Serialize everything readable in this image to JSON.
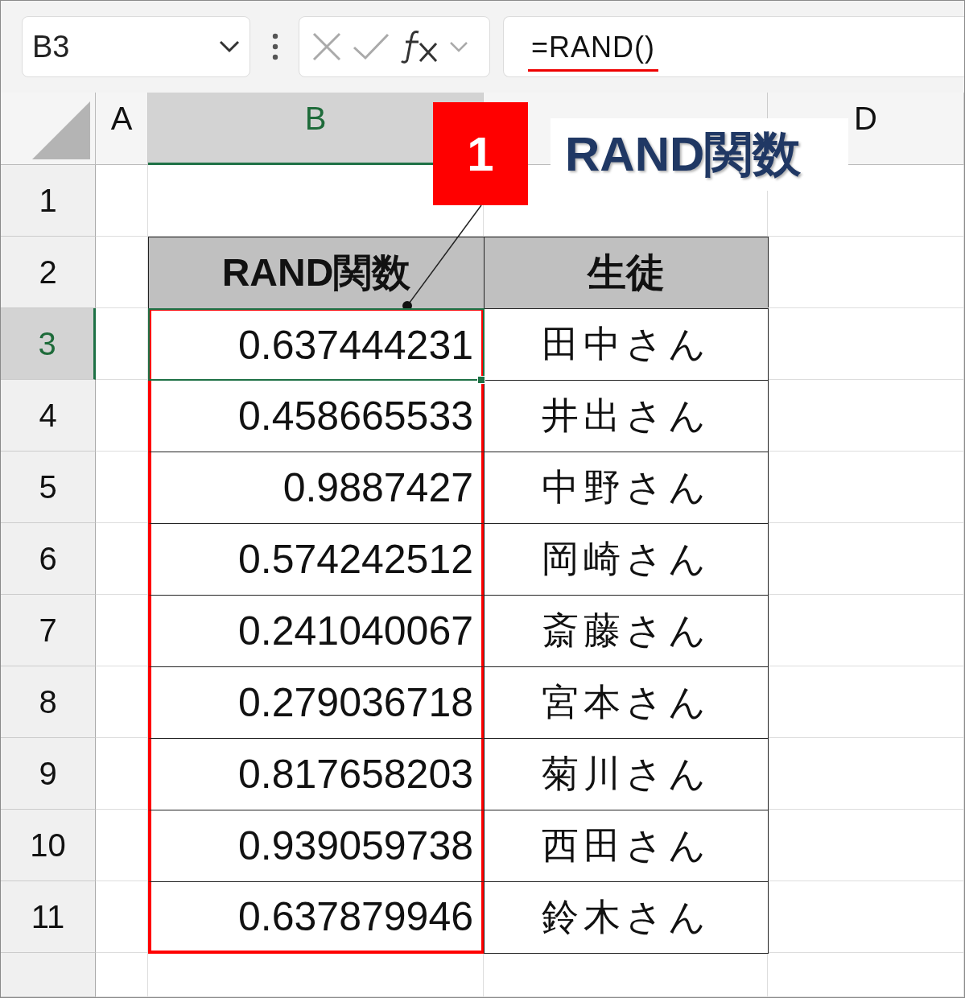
{
  "name_box": {
    "value": "B3"
  },
  "formula_bar": {
    "formula": "=RAND()"
  },
  "columns": [
    {
      "label": "A",
      "selected": false
    },
    {
      "label": "B",
      "selected": true
    },
    {
      "selected": false
    },
    {
      "label": "D",
      "selected": false
    }
  ],
  "rows": [
    {
      "label": "1",
      "selected": false
    },
    {
      "label": "2",
      "selected": false
    },
    {
      "label": "3",
      "selected": true
    },
    {
      "label": "4",
      "selected": false
    },
    {
      "label": "5",
      "selected": false
    },
    {
      "label": "6",
      "selected": false
    },
    {
      "label": "7",
      "selected": false
    },
    {
      "label": "8",
      "selected": false
    },
    {
      "label": "9",
      "selected": false
    },
    {
      "label": "10",
      "selected": false
    },
    {
      "label": "11",
      "selected": false
    },
    {
      "selected": false
    }
  ],
  "table": {
    "headers": [
      "RAND関数",
      "生徒"
    ],
    "rows": [
      {
        "value": "0.637444231",
        "student": "田中さん",
        "selected": true
      },
      {
        "value": "0.458665533",
        "student": "井出さん",
        "selected": false
      },
      {
        "value": "0.9887427",
        "student": "中野さん",
        "selected": false
      },
      {
        "value": "0.574242512",
        "student": "岡崎さん",
        "selected": false
      },
      {
        "value": "0.241040067",
        "student": "斎藤さん",
        "selected": false
      },
      {
        "value": "0.279036718",
        "student": "宮本さん",
        "selected": false
      },
      {
        "value": "0.817658203",
        "student": "菊川さん",
        "selected": false
      },
      {
        "value": "0.939059738",
        "student": "西田さん",
        "selected": false
      },
      {
        "value": "0.637879946",
        "student": "鈴木さん",
        "selected": false
      }
    ]
  },
  "annotation": {
    "number": "1",
    "label": "RAND関数"
  }
}
